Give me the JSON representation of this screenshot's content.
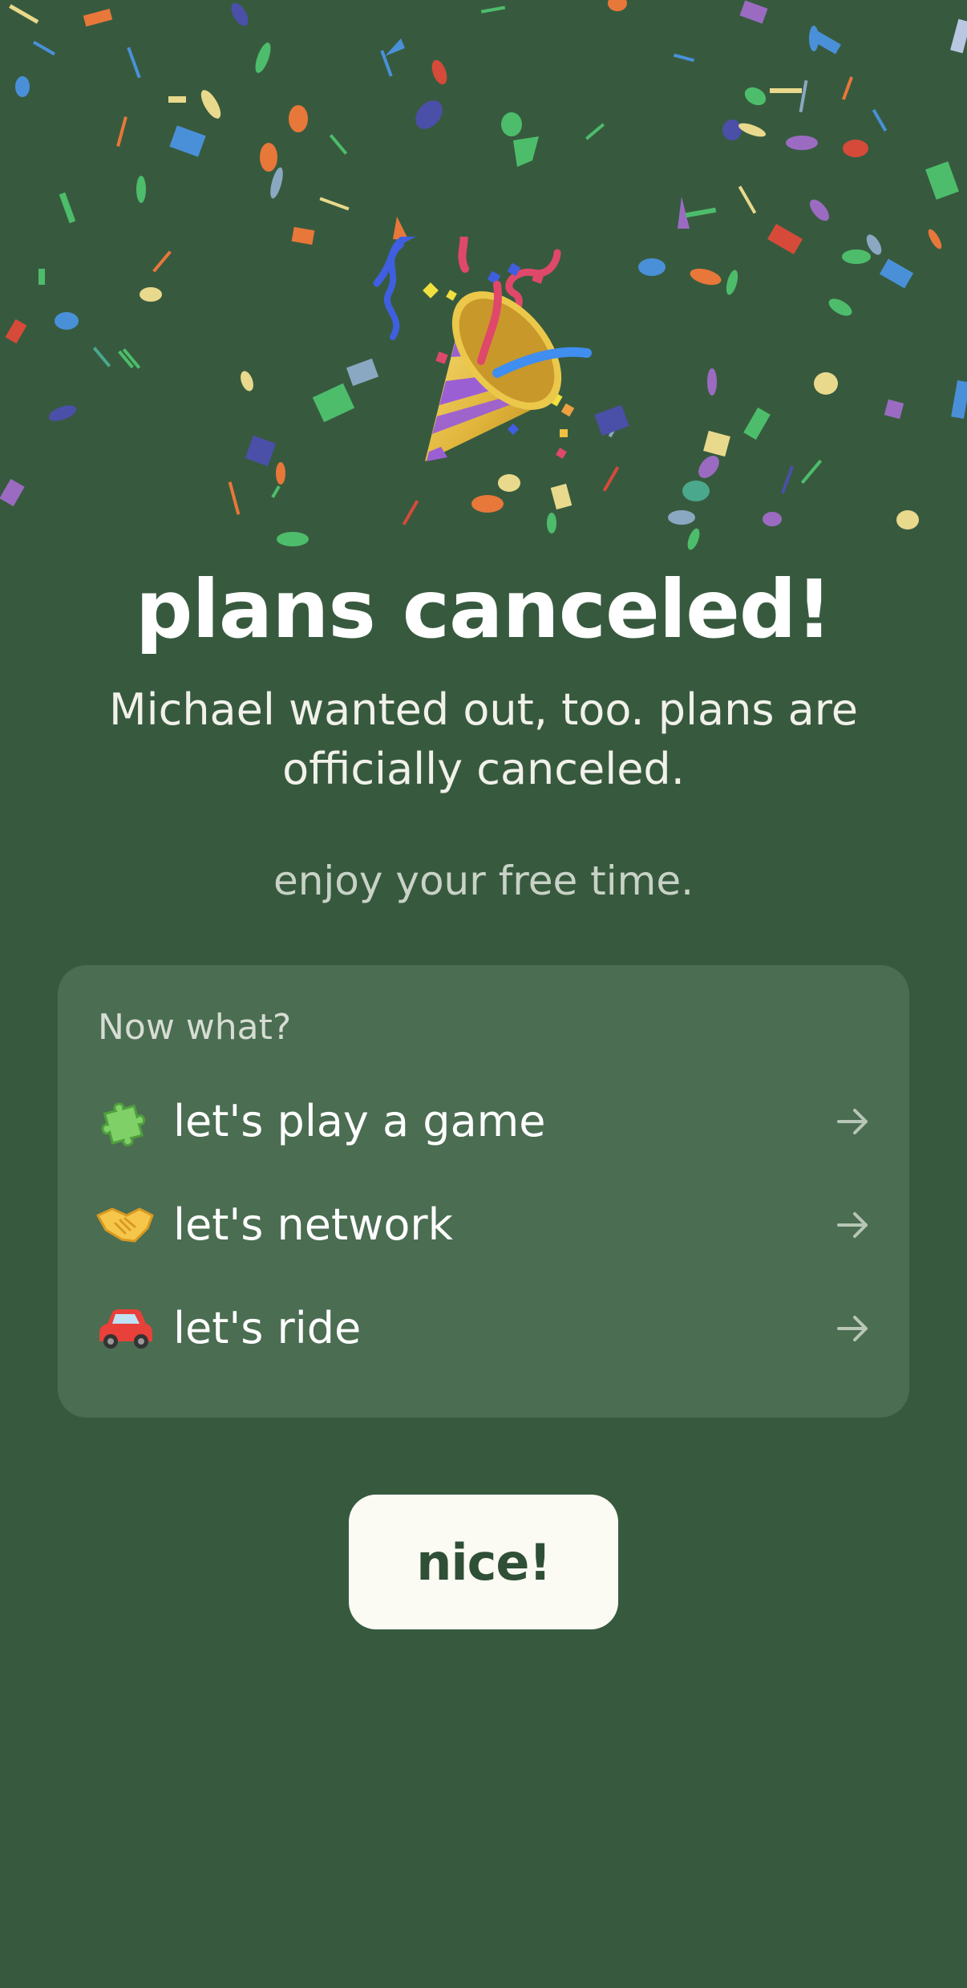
{
  "celebration": {
    "title": "plans canceled!",
    "subtitle": "Michael wanted out, too. plans are officially canceled.",
    "tagline": "enjoy your free time."
  },
  "next_steps": {
    "heading": "Now what?",
    "options": [
      {
        "label": "let's play a game",
        "icon": "puzzle-piece-icon"
      },
      {
        "label": "let's network",
        "icon": "handshake-icon"
      },
      {
        "label": "let's ride",
        "icon": "car-icon"
      }
    ]
  },
  "actions": {
    "confirm_label": "nice!"
  },
  "colors": {
    "background": "#375a3e",
    "card": "#4b6d52",
    "button": "#fbfbf4",
    "button_text": "#2f4f36"
  }
}
